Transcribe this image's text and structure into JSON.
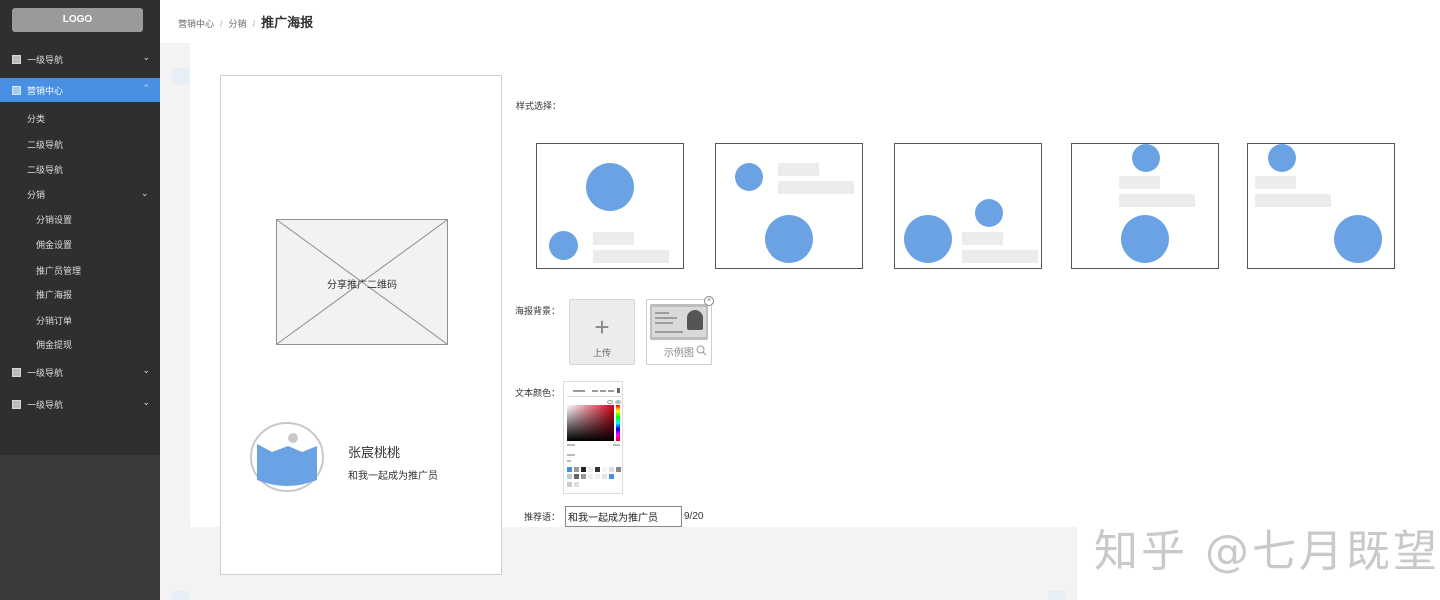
{
  "sidebar": {
    "logo": "LOGO",
    "nav": [
      {
        "label": "一级导航",
        "chevron": "⌄"
      },
      {
        "label": "营销中心",
        "chevron": "⌃"
      },
      {
        "label": "一级导航",
        "chevron": "⌄"
      },
      {
        "label": "一级导航",
        "chevron": "⌄"
      }
    ],
    "sub": [
      "分类",
      "二级导航",
      "二级导航",
      "分销"
    ],
    "sub_chevron": "⌄",
    "subsub": [
      "分销设置",
      "佣金设置",
      "推广员管理",
      "推广海报",
      "分销订单",
      "佣金提现"
    ]
  },
  "breadcrumb": {
    "items": [
      "营销中心",
      "分销"
    ],
    "separator": "/",
    "current": "推广海报"
  },
  "poster": {
    "qr_label": "分享推广二维码",
    "name": "张宸桃桃",
    "slogan": "和我一起成为推广员"
  },
  "form": {
    "style_label": "样式选择：",
    "bg_label": "海报背景：",
    "upload_icon": "+",
    "upload_text": "上传",
    "sample_text": "示例图",
    "close_icon": "×",
    "color_label": "文本颜色：",
    "slogan_label": "推荐语：",
    "slogan_value": "和我一起成为推广员",
    "counter": "9/20"
  },
  "colors": {
    "accent": "#4a90e2",
    "sidebar": "#2f2f2f",
    "placeholder_circle": "#6aa2e4"
  },
  "watermark": "知乎 @七月既望"
}
